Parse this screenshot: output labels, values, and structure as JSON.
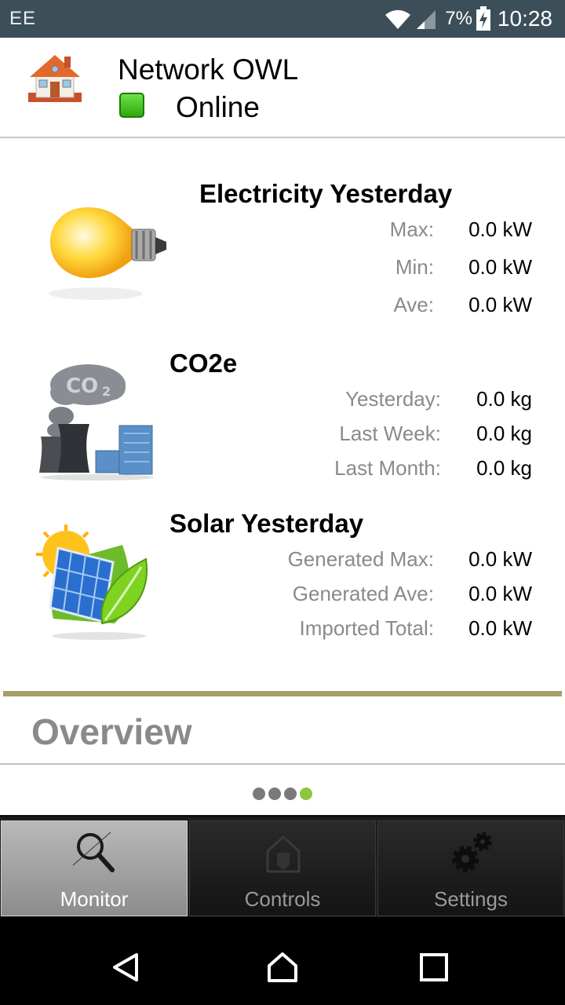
{
  "status_bar": {
    "carrier": "EE",
    "battery": "7%",
    "time": "10:28"
  },
  "header": {
    "device_name": "Network OWL",
    "status": "Online",
    "status_color": "#3cc41a"
  },
  "electricity": {
    "title": "Electricity Yesterday",
    "rows": [
      {
        "label": "Max:",
        "value": "0.0 kW"
      },
      {
        "label": "Min:",
        "value": "0.0 kW"
      },
      {
        "label": "Ave:",
        "value": "0.0 kW"
      }
    ]
  },
  "co2": {
    "title": "CO2e",
    "rows": [
      {
        "label": "Yesterday:",
        "value": "0.0 kg"
      },
      {
        "label": "Last Week:",
        "value": "0.0 kg"
      },
      {
        "label": "Last Month:",
        "value": "0.0 kg"
      }
    ]
  },
  "solar": {
    "title": "Solar Yesterday",
    "rows": [
      {
        "label": "Generated Max:",
        "value": "0.0 kW"
      },
      {
        "label": "Generated Ave:",
        "value": "0.0 kW"
      },
      {
        "label": "Imported Total:",
        "value": "0.0 kW"
      }
    ]
  },
  "overview": {
    "title": "Overview",
    "pager": {
      "pages": 4,
      "active": 4
    }
  },
  "tabs": [
    {
      "label": "Monitor",
      "icon": "magnifier-icon",
      "selected": true
    },
    {
      "label": "Controls",
      "icon": "home-control-icon",
      "selected": false
    },
    {
      "label": "Settings",
      "icon": "gears-icon",
      "selected": false
    }
  ],
  "colors": {
    "status_bar": "#3c4e58",
    "accent_rule": "#a6a069",
    "pager_active": "#8dc63f"
  }
}
